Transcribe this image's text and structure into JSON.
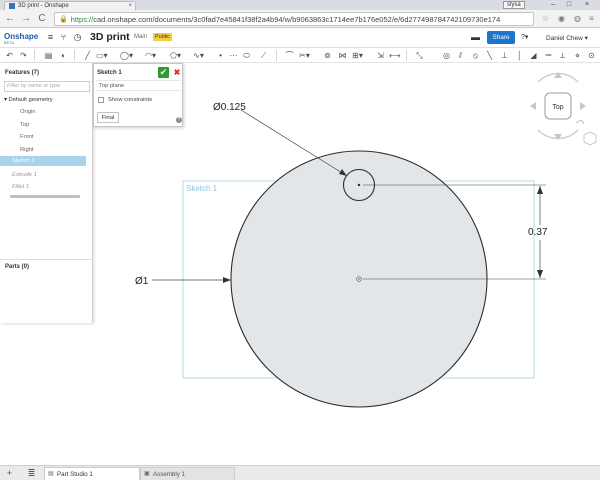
{
  "browser": {
    "tab_title": "3D print - Onshape",
    "tab_close": "×",
    "user_badge": "slysa",
    "win_min": "–",
    "win_max": "□",
    "win_close": "×",
    "nav_back": "←",
    "nav_forward": "→",
    "nav_reload": "C",
    "url_scheme": "https://",
    "url_rest": "cad.onshape.com/documents/3c0fad7e45841f38f2a4b94/w/b9063863c1714ee7b176e052/e/6d277498784742109730e174",
    "lock": "🔒",
    "star": "☆",
    "menu": "≡"
  },
  "app_header": {
    "logo": "Onshape",
    "logo_sub": "BETA",
    "menu_icon": "≡",
    "doc_title": "3D print",
    "branch": "Main",
    "badge": "Public",
    "share_label": "Share",
    "help_label": "?▾",
    "user_name": "Daniel Chew ▾"
  },
  "features": {
    "title": "Features (7)",
    "filter_placeholder": "Filter by name or type",
    "items": [
      {
        "label": "▾ Default geometry"
      },
      {
        "label": "Origin"
      },
      {
        "label": "Top"
      },
      {
        "label": "Front"
      },
      {
        "label": "Right"
      },
      {
        "label": "Sketch 1"
      },
      {
        "label": "Extrude 1"
      },
      {
        "label": "Fillet 1"
      }
    ],
    "parts_title": "Parts (0)"
  },
  "sketch_dialog": {
    "title": "Sketch 1",
    "ok": "✔",
    "cancel": "✖",
    "plane": "Top plane",
    "show_constraints": "Show constraints",
    "final": "Final",
    "help": "?"
  },
  "viewport": {
    "sketch_label": "Sketch 1",
    "dim_small_circle": "Ø0.125",
    "dim_large_circle": "Ø1",
    "dim_distance": "0.37",
    "view_cube_label": "Top",
    "colors": {
      "sketch_fill": "#e3e6e8",
      "sketch_stroke": "#2d2d2d",
      "sketch_box": "#9fd1e3"
    }
  },
  "bottom": {
    "add_icon": "+",
    "list_icon": "≣",
    "tabs": [
      {
        "label": "Part Studio 1",
        "active": true
      },
      {
        "label": "Assembly 1",
        "active": false
      }
    ]
  }
}
